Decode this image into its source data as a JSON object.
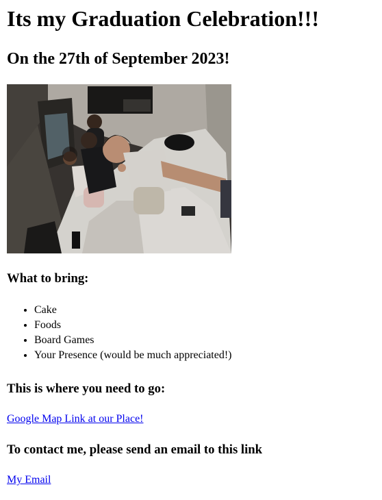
{
  "heading": "Its my Graduation Celebration!!!",
  "date_heading": "On the 27th of September 2023!",
  "photo": {
    "alt": "Four friends taking a selfie on a bed in a dimly lit room"
  },
  "bring_heading": "What to bring:",
  "bring_items": [
    "Cake",
    "Foods",
    "Board Games",
    "Your Presence (would be much appreciated!)"
  ],
  "location_heading": "This is where you need to go:",
  "map_link_text": "Google Map Link at our Place!",
  "contact_heading": "To contact me, please send an email to this link",
  "email_link_text": "My Email",
  "colors": {
    "link": "#0000ee",
    "text": "#000000",
    "background": "#ffffff"
  }
}
